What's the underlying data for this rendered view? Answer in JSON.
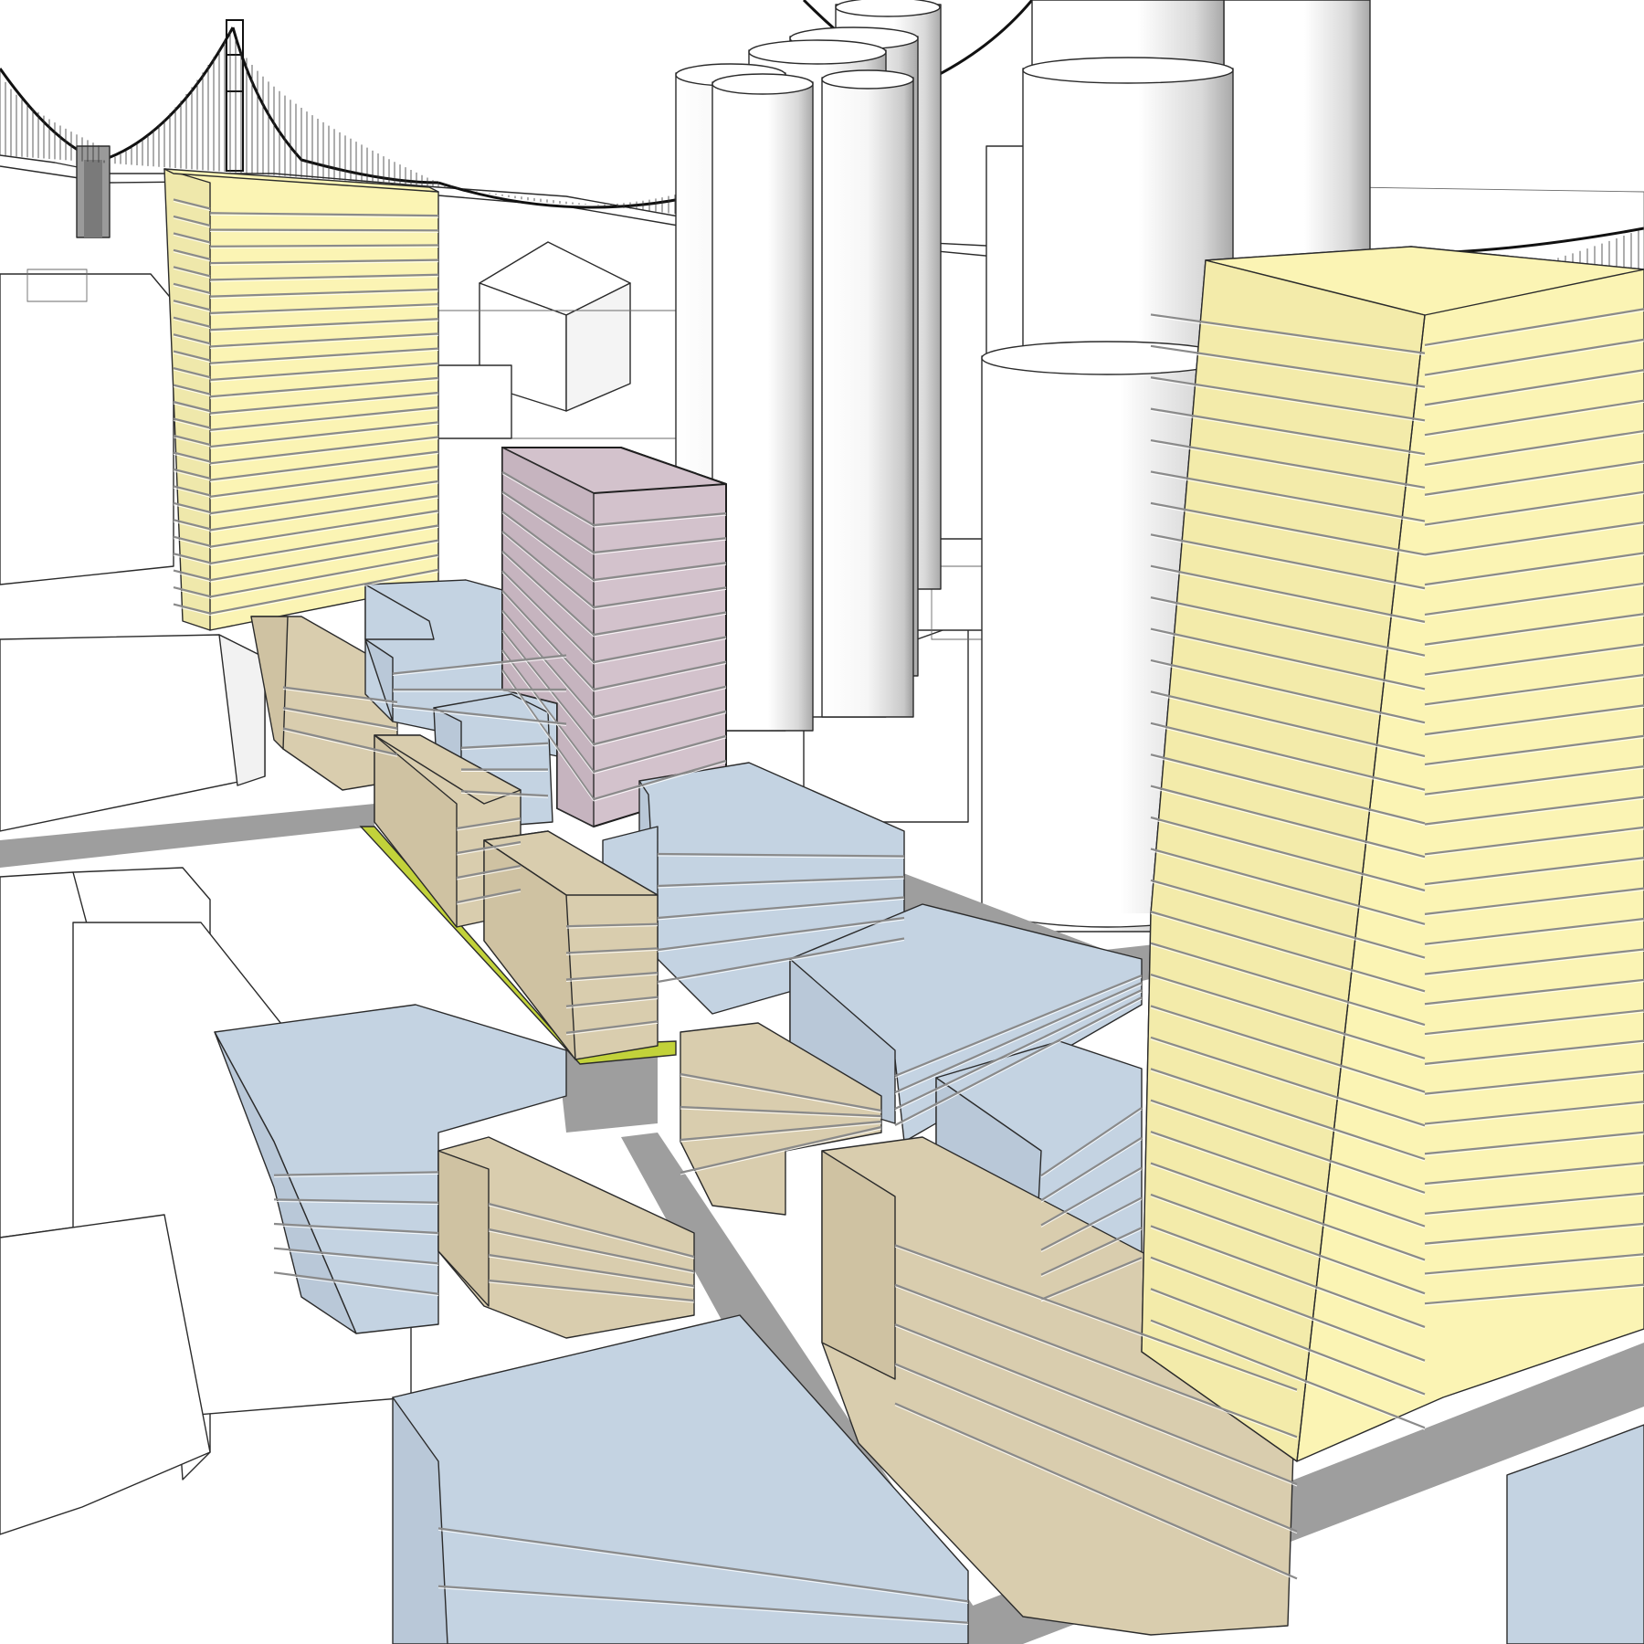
{
  "scene": {
    "kind": "3d-massing-model",
    "colors": {
      "background": "#ffffff",
      "context_building": "#ffffff",
      "context_shade": "#f1f1f1",
      "street": "#9e9e9e",
      "highrise_residential": "#fbf4b4",
      "midrise_blue": "#c4d3e2",
      "midrise_tan": "#d9cdae",
      "tower_mauve": "#d3c2cc",
      "site_green": "#c2d23a",
      "bridge": "#222222"
    }
  }
}
